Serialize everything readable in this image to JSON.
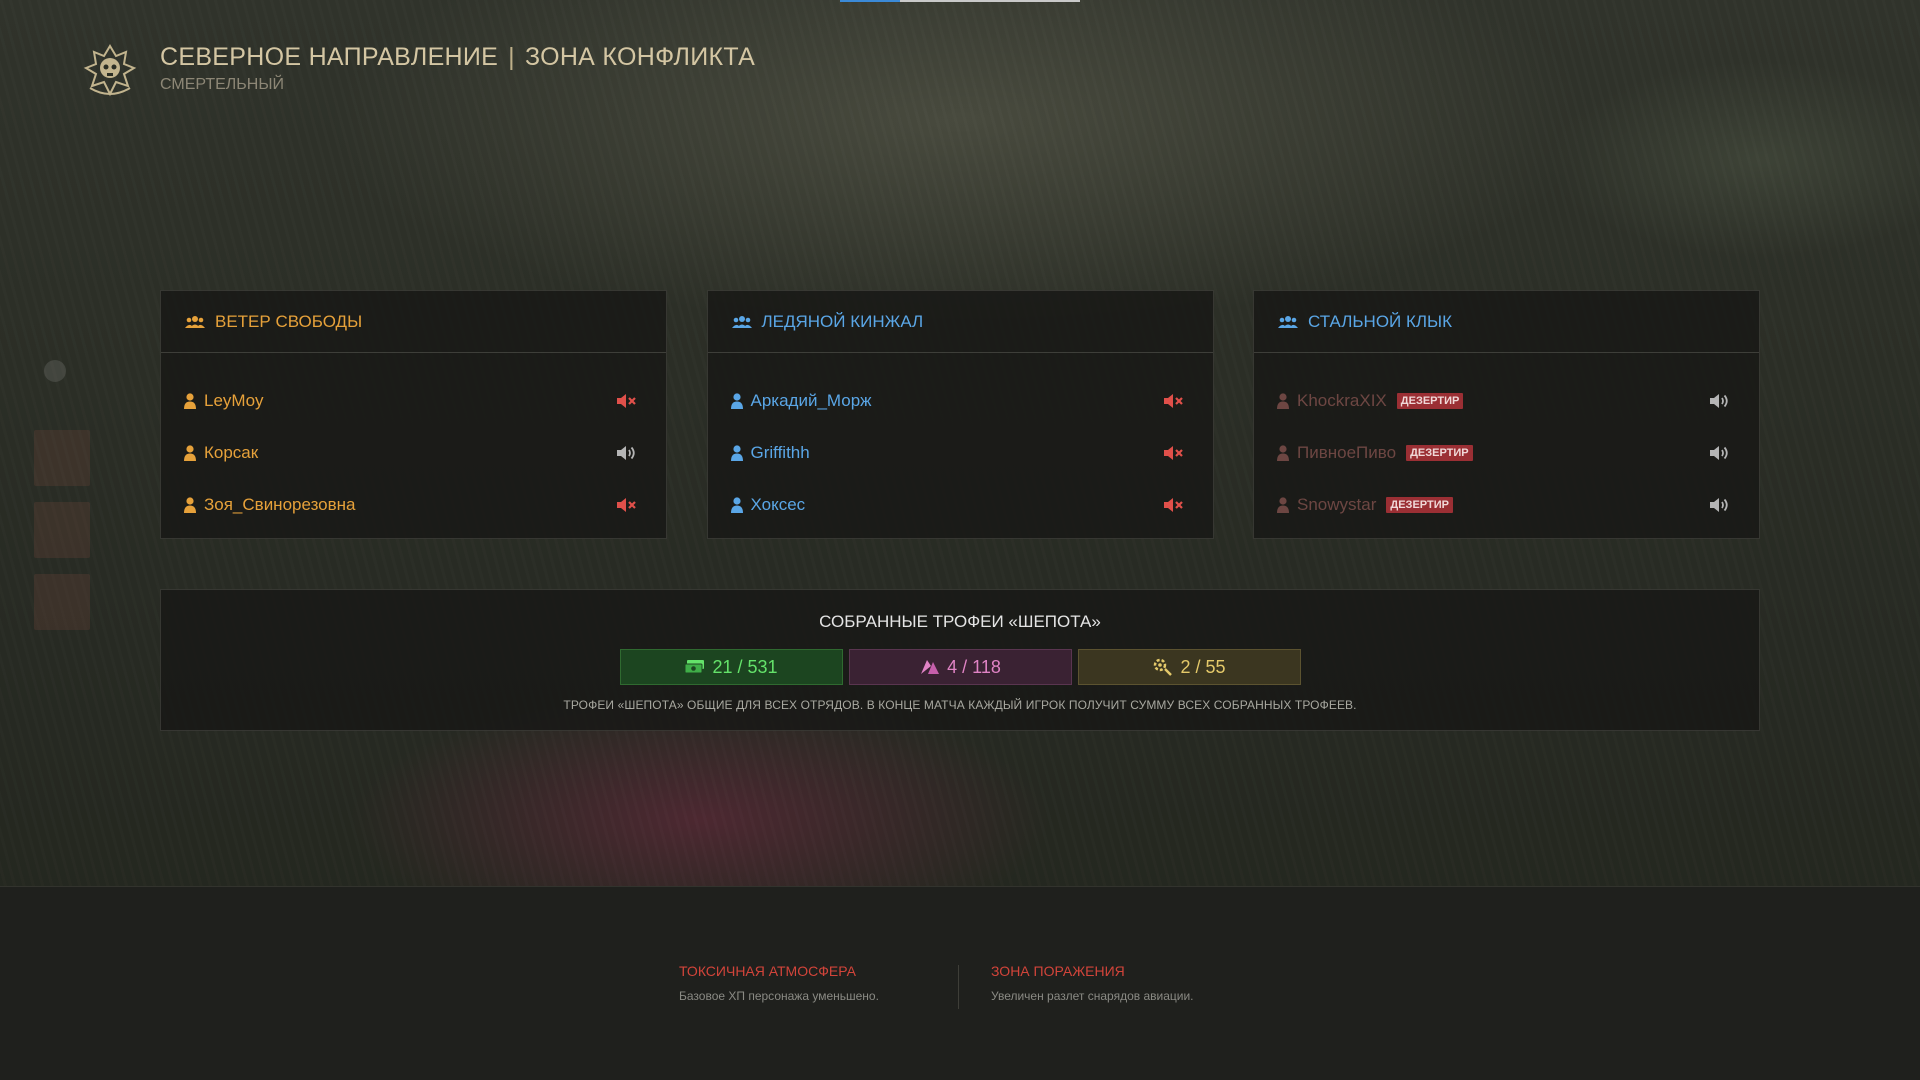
{
  "header": {
    "title_left": "СЕВЕРНОЕ НАПРАВЛЕНИЕ",
    "title_sep": "|",
    "title_right": "ЗОНА КОНФЛИКТА",
    "subtitle": "СМЕРТЕЛЬНЫЙ",
    "emblem_icon": "skull-emblem-icon"
  },
  "loading_progress": 0.25,
  "teams": [
    {
      "name": "ВЕТЕР СВОБОДЫ",
      "color": "#e6a13a",
      "players": [
        {
          "name": "LeyMoy",
          "muted": true,
          "deserter": false
        },
        {
          "name": "Корсак",
          "muted": false,
          "deserter": false
        },
        {
          "name": "Зоя_Свинорезовна",
          "muted": true,
          "deserter": false
        }
      ]
    },
    {
      "name": "ЛЕДЯНОЙ КИНЖАЛ",
      "color": "#5aa6e6",
      "players": [
        {
          "name": "Аркадий_Морж",
          "muted": true,
          "deserter": false
        },
        {
          "name": "Griffithh",
          "muted": true,
          "deserter": false
        },
        {
          "name": "Хоксес",
          "muted": true,
          "deserter": false
        }
      ]
    },
    {
      "name": "СТАЛЬНОЙ КЛЫК",
      "color": "#5aa6e6",
      "players": [
        {
          "name": "KhockraXIX",
          "muted": false,
          "deserter": true
        },
        {
          "name": "ПивноеПиво",
          "muted": false,
          "deserter": true
        },
        {
          "name": "Snowystar",
          "muted": false,
          "deserter": true
        }
      ]
    }
  ],
  "deserter_label": "ДЕЗЕРТИР",
  "colors": {
    "deserter_name": "#b06a66",
    "muted_icon": "#e0504a",
    "sound_icon": "#b5b5b5"
  },
  "trophies": {
    "title": "СОБРАННЫЕ ТРОФЕИ «ШЕПОТА»",
    "counters": [
      {
        "icon": "cash-icon",
        "value": "21 / 531"
      },
      {
        "icon": "crystal-icon",
        "value": "4 / 118"
      },
      {
        "icon": "gear-part-icon",
        "value": "2 / 55"
      }
    ],
    "note": "ТРОФЕИ «ШЕПОТА» ОБЩИЕ ДЛЯ ВСЕХ ОТРЯДОВ. В КОНЦЕ МАТЧА КАЖДЫЙ ИГРОК ПОЛУЧИТ СУММУ ВСЕХ СОБРАННЫХ ТРОФЕЕВ."
  },
  "modifiers": [
    {
      "name": "ТОКСИЧНАЯ АТМОСФЕРА",
      "desc": "Базовое ХП персонажа уменьшено."
    },
    {
      "name": "ЗОНА ПОРАЖЕНИЯ",
      "desc": "Увеличен разлет снарядов авиации."
    }
  ]
}
